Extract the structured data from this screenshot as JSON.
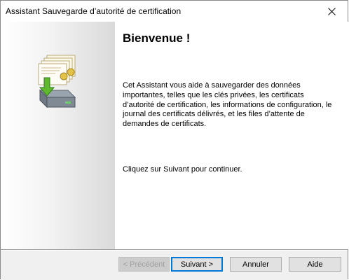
{
  "window": {
    "title": "Assistant Sauvegarde d’autorité de certification"
  },
  "icons": {
    "close": "close-icon",
    "wizard_art": "certificate-backup-icon"
  },
  "content": {
    "heading": "Bienvenue !",
    "intro": "Cet Assistant vous aide à sauvegarder des données importantes, telles que les clés privées, les certificats d’autorité de certification, les informations de configuration, le journal des certificats délivrés, et les files d’attente de demandes de certificats.",
    "continue_hint": "Cliquez sur Suivant pour continuer."
  },
  "buttons": {
    "previous": "< Précédent",
    "next": "Suivant >",
    "cancel": "Annuler",
    "help": "Aide"
  },
  "state": {
    "previous_enabled": false,
    "default_button": "next"
  },
  "colors": {
    "accent": "#0078d7",
    "footer_bg": "#f0f0f0",
    "arrow_green": "#5fb82e"
  }
}
